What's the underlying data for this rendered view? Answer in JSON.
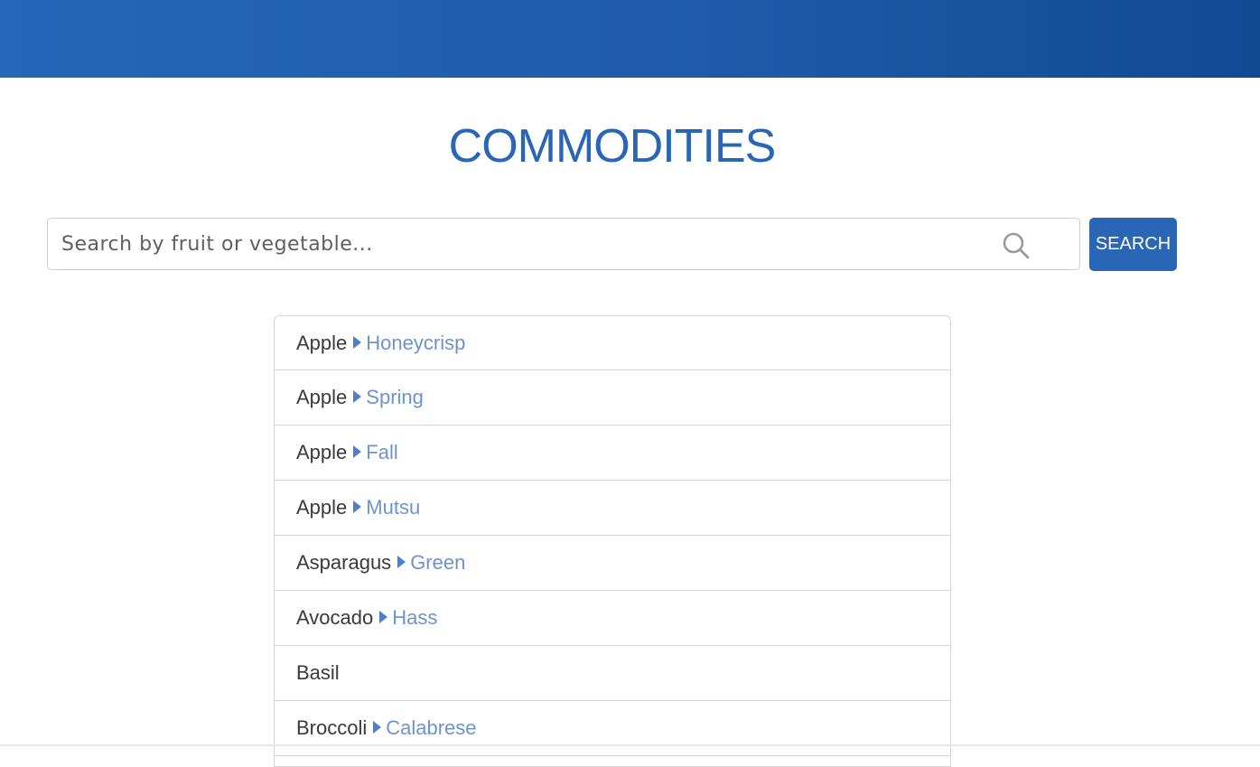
{
  "page": {
    "title": "COMMODITIES"
  },
  "search": {
    "placeholder": "Search by fruit or vegetable...",
    "value": "",
    "button_label": "SEARCH",
    "icon": "search-icon"
  },
  "colors": {
    "brand_blue": "#2a66b6",
    "banner_dark": "#124a92",
    "variety_text": "#6d93cf",
    "caret": "#4f7fc4"
  },
  "commodities": [
    {
      "name": "Apple",
      "variety": "Honeycrisp"
    },
    {
      "name": "Apple",
      "variety": "Spring"
    },
    {
      "name": "Apple",
      "variety": "Fall"
    },
    {
      "name": "Apple",
      "variety": "Mutsu"
    },
    {
      "name": "Asparagus",
      "variety": "Green"
    },
    {
      "name": "Avocado",
      "variety": "Hass"
    },
    {
      "name": "Basil",
      "variety": ""
    },
    {
      "name": "Broccoli",
      "variety": "Calabrese"
    }
  ]
}
